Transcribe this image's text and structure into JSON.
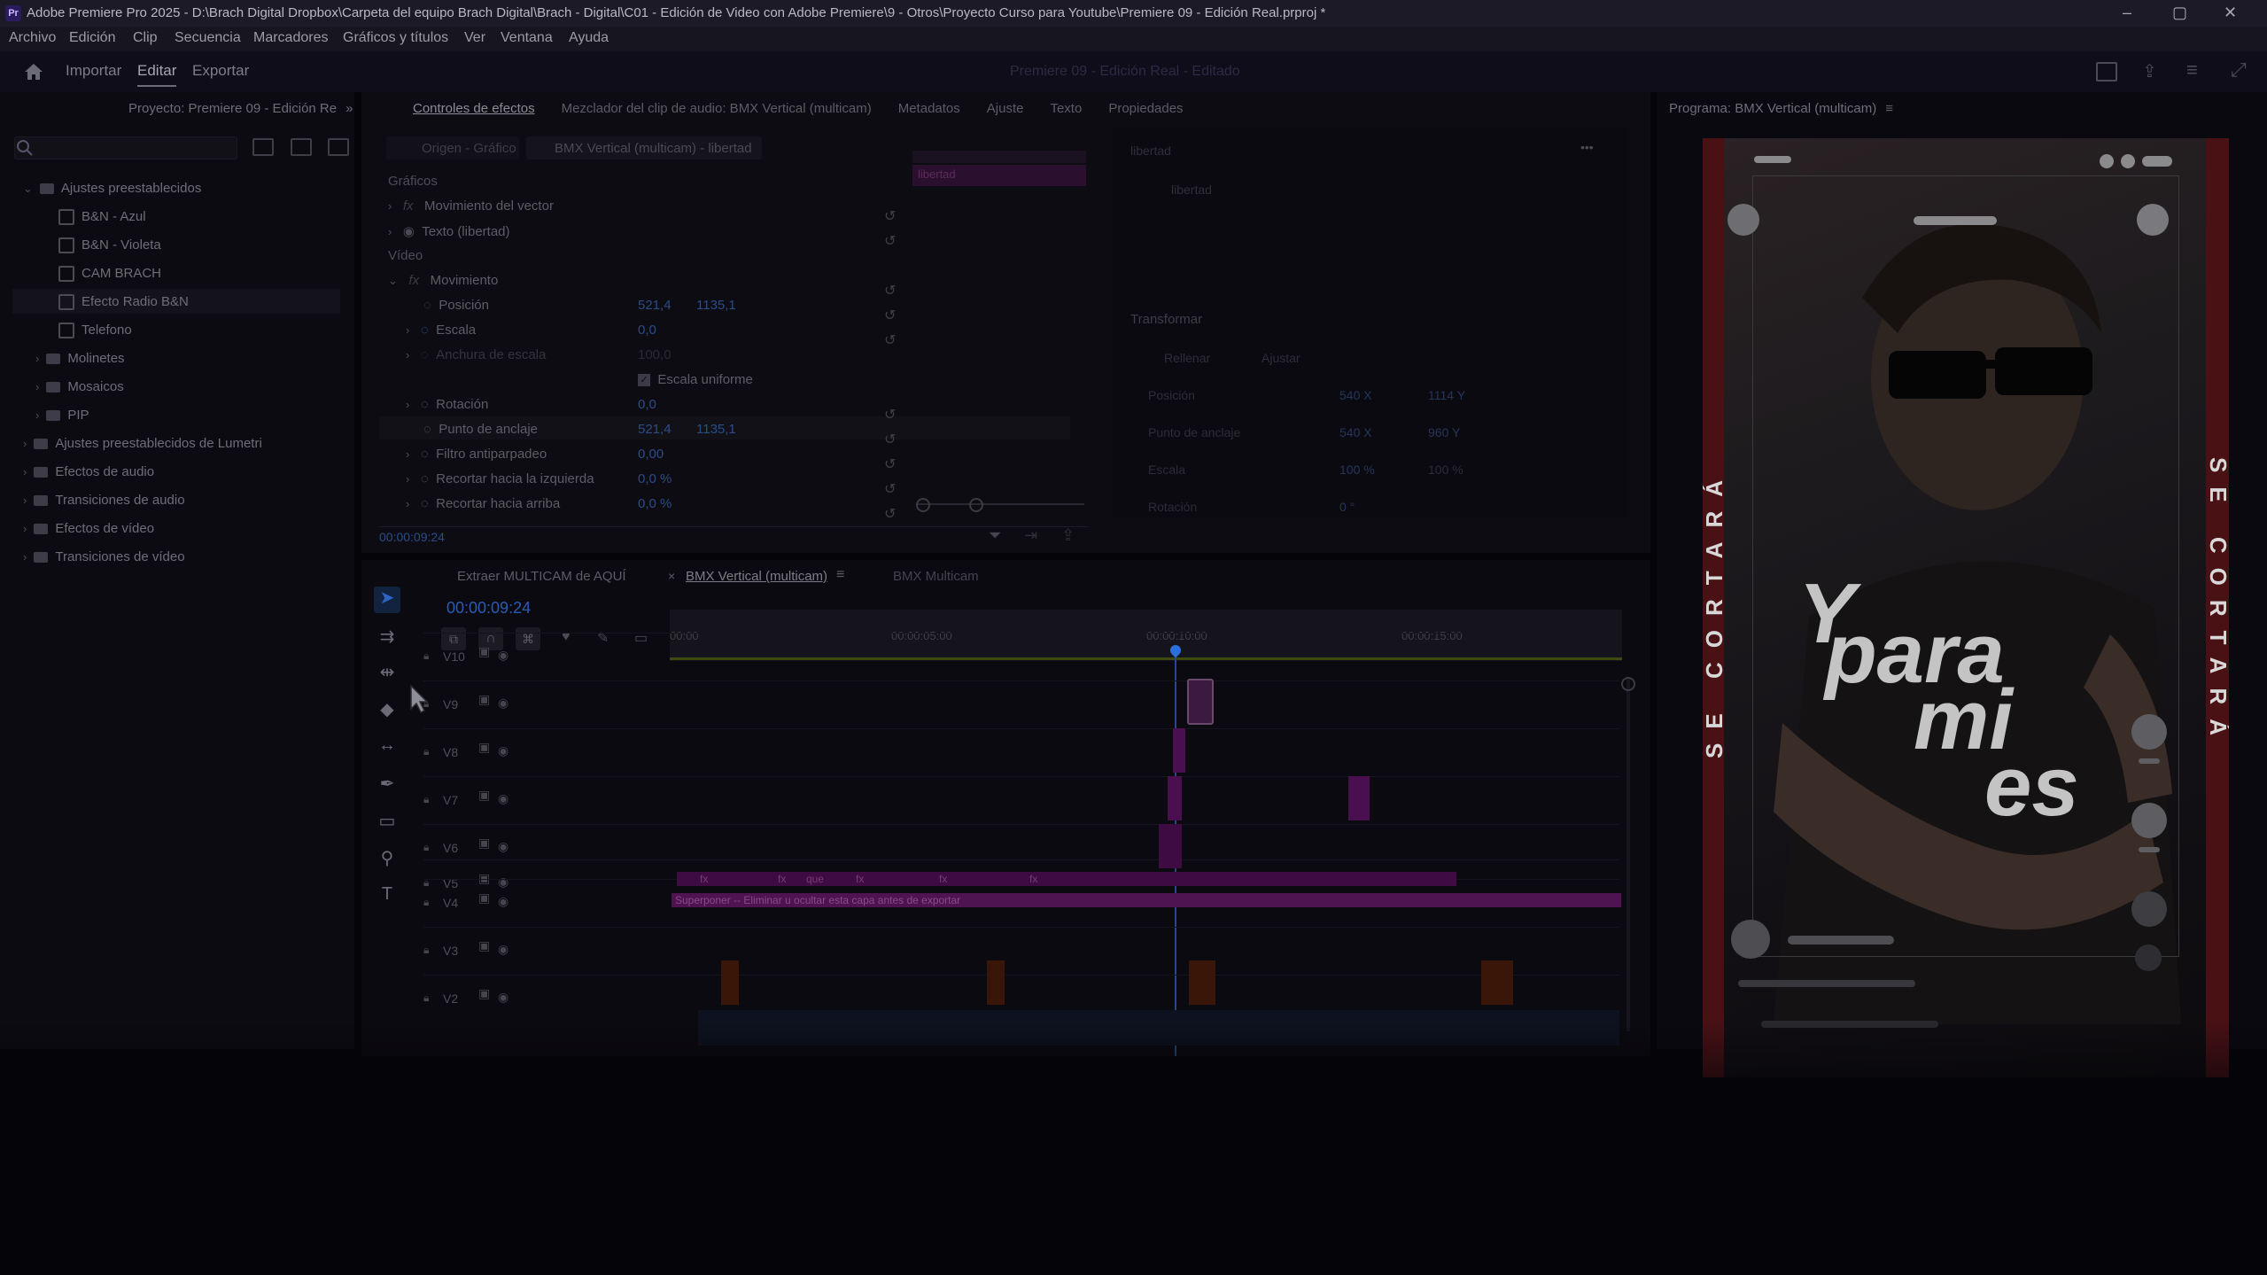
{
  "titlebar": {
    "app_icon": "Pr",
    "title_main": "Adobe Premiere Pro 2025 - D:\\Brach Digital Dropbox\\Carpeta del equipo Brach Digital\\Brach - Digital\\C01 - Edición de Video con Adobe Premiere\\9 - Otros\\Proyecto Curso para Youtube\\Premiere 09 - Edición Real.prproj *",
    "minimize": "–",
    "maximize": "▢",
    "close": "✕"
  },
  "menubar": {
    "items": [
      "Archivo",
      "Edición",
      "Clip",
      "Secuencia",
      "Marcadores",
      "Gráficos y títulos",
      "Ver",
      "Ventana",
      "Ayuda"
    ]
  },
  "workspace": {
    "tabs": [
      "Importar",
      "Editar",
      "Exportar"
    ],
    "active": "Editar",
    "center_title": "Premiere 09 - Edición Real - Editado"
  },
  "project_panel": {
    "title": "Proyecto: Premiere 09 - Edición Re",
    "expand_icon": "»",
    "search_placeholder": "",
    "tree": [
      {
        "label": "Ajustes preestablecidos",
        "level": 0,
        "type": "folder",
        "expanded": true
      },
      {
        "label": "B&N - Azul",
        "level": 1,
        "type": "preset"
      },
      {
        "label": "B&N - Violeta",
        "level": 1,
        "type": "preset"
      },
      {
        "label": "CAM BRACH",
        "level": 1,
        "type": "preset"
      },
      {
        "label": "Efecto Radio B&N",
        "level": 1,
        "type": "preset",
        "selected": true
      },
      {
        "label": "Telefono",
        "level": 1,
        "type": "preset"
      },
      {
        "label": "Molinetes",
        "level": 1,
        "type": "folder"
      },
      {
        "label": "Mosaicos",
        "level": 1,
        "type": "folder"
      },
      {
        "label": "PIP",
        "level": 1,
        "type": "folder"
      },
      {
        "label": "Ajustes preestablecidos de Lumetri",
        "level": 0,
        "type": "folder"
      },
      {
        "label": "Efectos de audio",
        "level": 0,
        "type": "folder"
      },
      {
        "label": "Transiciones de audio",
        "level": 0,
        "type": "folder"
      },
      {
        "label": "Efectos de vídeo",
        "level": 0,
        "type": "folder"
      },
      {
        "label": "Transiciones de vídeo",
        "level": 0,
        "type": "folder"
      }
    ]
  },
  "effect_controls": {
    "tabs": [
      "Controles de efectos",
      "Mezclador del clip de audio: BMX Vertical (multicam)",
      "Metadatos",
      "Ajuste",
      "Texto",
      "Propiedades"
    ],
    "source_tab": "Origen - Gráfico",
    "sequence_tab": "BMX Vertical (multicam) - libertad",
    "mini_clip_label": "libertad",
    "sections": {
      "graphics": "Gráficos",
      "video": "Vídeo"
    },
    "rows": [
      {
        "label": "Movimiento del vector",
        "fx": true
      },
      {
        "label": "Texto (libertad)",
        "fx": false
      },
      {
        "label": "Movimiento",
        "fx": true
      },
      {
        "label": "Posición",
        "v1": "521,4",
        "v2": "1135,1"
      },
      {
        "label": "Escala",
        "v1": "0,0"
      },
      {
        "label": "Anchura de escala",
        "v1": "100,0"
      },
      {
        "label": "Escala uniforme",
        "checkbox": true
      },
      {
        "label": "Rotación",
        "v1": "0,0"
      },
      {
        "label": "Punto de anclaje",
        "v1": "521,4",
        "v2": "1135,1"
      },
      {
        "label": "Filtro antiparpadeo",
        "v1": "0,00"
      },
      {
        "label": "Recortar hacia la izquierda",
        "v1": "0,0 %"
      },
      {
        "label": "Recortar hacia arriba",
        "v1": "0,0 %"
      }
    ],
    "timecode": "00:00:09:24"
  },
  "properties_panel": {
    "layer_name": "libertad",
    "text_layer": "libertad",
    "more_icon": "•••",
    "transform_title": "Transformar",
    "fill_label": "Rellenar",
    "adjust_label": "Ajustar",
    "fields": [
      {
        "label": "Posición",
        "v1": "540 X",
        "v2": "1114 Y"
      },
      {
        "label": "Punto de anclaje",
        "v1": "540 X",
        "v2": "960 Y"
      },
      {
        "label": "Escala",
        "v1": "100 %",
        "v2": "100 %"
      },
      {
        "label": "Rotación",
        "v1": "0 °"
      }
    ]
  },
  "program_monitor": {
    "title": "Programa: BMX Vertical (multicam)",
    "overlay_text_lines": [
      "Y",
      "para",
      "mi",
      "es"
    ],
    "side_text_left": "SE CORTARÁ",
    "side_text_right": "SE CORTARÁ"
  },
  "timeline": {
    "tabs": [
      "Extraer MULTICAM de AQUÍ",
      "BMX Vertical (multicam)",
      "BMX Multicam"
    ],
    "active_tab": "BMX Vertical (multicam)",
    "timecode": "00:00:09:24",
    "ruler": [
      "00:00",
      "00:00:05:00",
      "00:00:10:00",
      "00:00:15:00"
    ],
    "playhead_progress": 0.53,
    "tracks": [
      "V10",
      "V9",
      "V8",
      "V7",
      "V6",
      "V5",
      "V4",
      "V3",
      "V2"
    ],
    "superpose_label": "Superponer -- Eliminar u ocultar esta capa antes de exportar",
    "fx_markers": [
      "fx",
      "fx",
      "que",
      "fx",
      "fx",
      "fx"
    ]
  },
  "colors": {
    "accent_blue": "#2a6fdb",
    "clip_magenta": "#6a1f6a",
    "clip_orange": "#5a2210",
    "panel_bg": "#0c0b11"
  }
}
